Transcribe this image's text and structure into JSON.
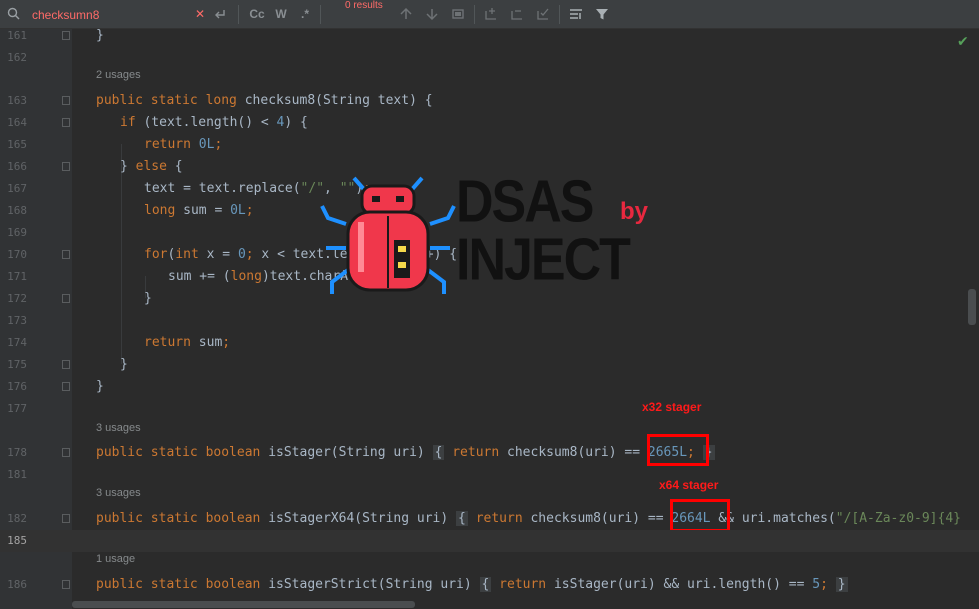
{
  "search": {
    "query": "checksumn8",
    "results": "0 results",
    "icons": [
      "search-icon",
      "clear-icon",
      "replace-icon",
      "match-case-icon",
      "words-icon",
      "regex-icon",
      "prev-occurrence-icon",
      "next-occurrence-icon",
      "select-all-icon",
      "add-selection-icon",
      "remove-selection-icon",
      "exclude-icon",
      "filter-settings-icon",
      "filter-icon"
    ],
    "match_case_label": "Cc",
    "words_label": "W",
    "regex_label": ".*"
  },
  "editor": {
    "status_icon": "inspection-ok-icon",
    "lines": [
      {
        "num": "161",
        "hint": "",
        "code": "}"
      },
      {
        "num": "162",
        "hint": "",
        "code": ""
      },
      {
        "num": "163",
        "hint": "2 usages",
        "code": "public static long checksum8(String text) {"
      },
      {
        "num": "164",
        "hint": "",
        "code": "if (text.length() < 4) {"
      },
      {
        "num": "165",
        "hint": "",
        "code": "return 0L;"
      },
      {
        "num": "166",
        "hint": "",
        "code": "} else {"
      },
      {
        "num": "167",
        "hint": "",
        "code": "text = text.replace(\"/\", \"\");"
      },
      {
        "num": "168",
        "hint": "",
        "code": "long sum = 0L;"
      },
      {
        "num": "169",
        "hint": "",
        "code": ""
      },
      {
        "num": "170",
        "hint": "",
        "code": "for(int x = 0; x < text.length(); x++) {"
      },
      {
        "num": "171",
        "hint": "",
        "code": "sum += (long)text.charAt(x);"
      },
      {
        "num": "172",
        "hint": "",
        "code": "}"
      },
      {
        "num": "173",
        "hint": "",
        "code": ""
      },
      {
        "num": "174",
        "hint": "",
        "code": "return sum;"
      },
      {
        "num": "175",
        "hint": "",
        "code": "}"
      },
      {
        "num": "176",
        "hint": "",
        "code": "}"
      },
      {
        "num": "177",
        "hint": "",
        "code": ""
      },
      {
        "num": "178",
        "hint": "3 usages",
        "code": "public static boolean isStager(String uri) { return checksum8(uri) == 2665L; }"
      },
      {
        "num": "181",
        "hint": "",
        "code": ""
      },
      {
        "num": "182",
        "hint": "3 usages",
        "code": "public static boolean isStagerX64(String uri) { return checksum8(uri) == 2664L && uri.matches(\"/[A-Za-z0-9]{4}"
      },
      {
        "num": "185",
        "hint": "",
        "code": ""
      },
      {
        "num": "186",
        "hint": "1 usage",
        "code": "public static boolean isStagerStrict(String uri) { return isStager(uri) && uri.length() == 5; }"
      }
    ]
  },
  "annotations": {
    "x32_label": "x32 stager",
    "x64_label": "x64 stager",
    "x32_value": "2665L",
    "x64_value": "2664L"
  },
  "logo": {
    "line1": "DSAS",
    "line2": "INJECT",
    "by": "by",
    "icon": "bug-icon",
    "colors": {
      "bug": "#f0374b",
      "legs": "#1e90ff",
      "text": "#111111",
      "by": "#e8283f"
    }
  },
  "colors": {
    "background": "#2b2b2b",
    "keyword": "#cc7832",
    "number": "#6897bb",
    "string": "#6a8759",
    "text": "#a9b7c6",
    "highlight": "#ff0000"
  }
}
